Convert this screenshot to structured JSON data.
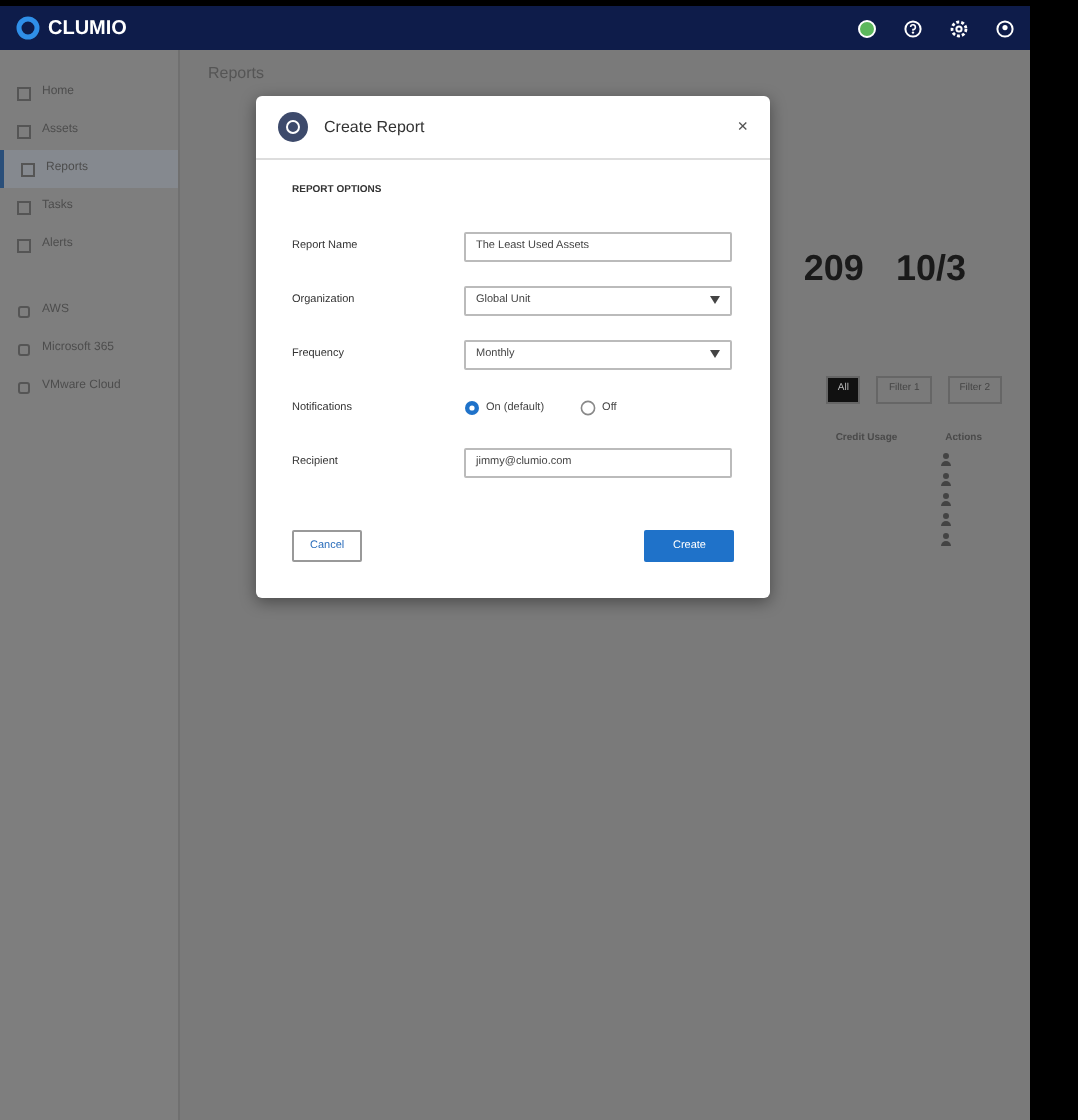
{
  "topbar": {
    "brand": "CLUMIO"
  },
  "sidebar": {
    "items": [
      {
        "label": "Home",
        "selected": false
      },
      {
        "label": "Assets",
        "selected": false
      },
      {
        "label": "Reports",
        "selected": true
      },
      {
        "label": "Tasks",
        "selected": false
      },
      {
        "label": "Alerts",
        "selected": false
      }
    ],
    "sources": [
      {
        "label": "AWS"
      },
      {
        "label": "Microsoft 365"
      },
      {
        "label": "VMware Cloud"
      }
    ]
  },
  "page": {
    "title": "Reports",
    "stats": [
      {
        "value": "209"
      },
      {
        "value": "10/3"
      }
    ],
    "filters": [
      {
        "label": "All",
        "selected": true
      },
      {
        "label": "Filter 1",
        "selected": false
      },
      {
        "label": "Filter 2",
        "selected": false
      }
    ],
    "columns": [
      "Credit Usage",
      "Actions"
    ]
  },
  "dialog": {
    "title": "Create Report",
    "close": "×",
    "section": "REPORT OPTIONS",
    "fields": [
      {
        "kind": "text",
        "label": "Report Name",
        "value": "The Least Used Assets"
      },
      {
        "kind": "select",
        "label": "Organization",
        "value": "Global Unit"
      },
      {
        "kind": "select",
        "label": "Frequency",
        "value": "Monthly"
      },
      {
        "kind": "radio",
        "label": "Notifications",
        "options": [
          {
            "label": "On (default)",
            "selected": true
          },
          {
            "label": "Off",
            "selected": false
          }
        ]
      },
      {
        "kind": "text",
        "label": "Recipient",
        "value": "jimmy@clumio.com"
      }
    ],
    "buttons": {
      "cancel": "Cancel",
      "create": "Create"
    }
  }
}
